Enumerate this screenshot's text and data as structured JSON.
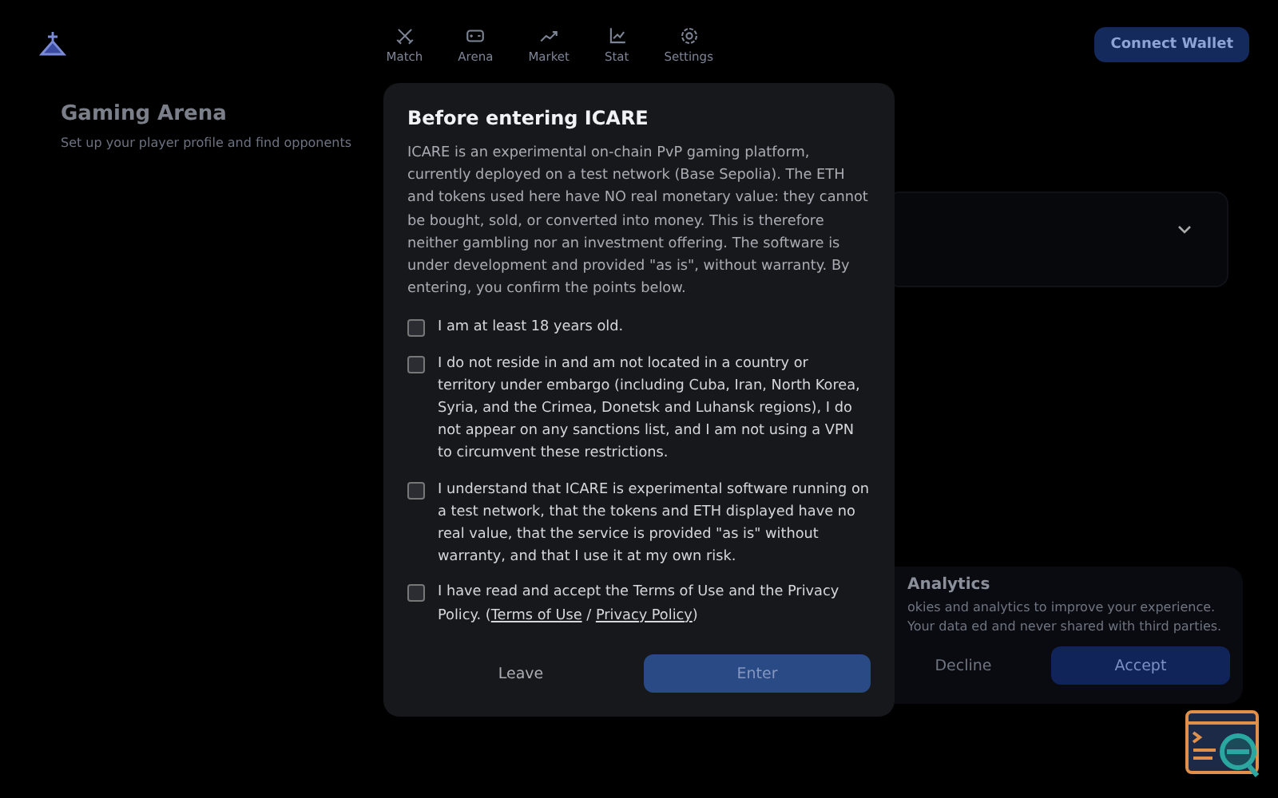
{
  "nav": [
    {
      "label": "Match"
    },
    {
      "label": "Arena"
    },
    {
      "label": "Market"
    },
    {
      "label": "Stat"
    },
    {
      "label": "Settings"
    }
  ],
  "connect_button": "Connect Wallet",
  "page": {
    "title": "Gaming Arena",
    "subtitle": "Set up your player profile and find opponents"
  },
  "analytics": {
    "title": "Analytics",
    "text": "okies and analytics to improve your experience. Your data ed and never shared with third parties.",
    "decline": "Decline",
    "accept": "Accept"
  },
  "modal": {
    "title": "Before entering ICARE",
    "body": "ICARE is an experimental on-chain PvP gaming platform, currently deployed on a test network (Base Sepolia). The ETH and tokens used here have NO real monetary value: they cannot be bought, sold, or converted into money. This is therefore neither gambling nor an investment offering. The software is under development and provided \"as is\", without warranty. By entering, you confirm the points below.",
    "items": [
      {
        "checked": false,
        "parts": [
          {
            "kind": "text",
            "text": "I am at least 18 years old."
          }
        ]
      },
      {
        "checked": false,
        "parts": [
          {
            "kind": "text",
            "text": "I do not reside in and am not located in a country or territory under embargo (including Cuba, Iran, North Korea, Syria, and the Crimea, Donetsk and Luhansk regions), I do not appear on any sanctions list, and I am not using a VPN to circumvent these restrictions."
          }
        ]
      },
      {
        "checked": false,
        "parts": [
          {
            "kind": "text",
            "text": "I understand that ICARE is experimental software running on a test network, that the tokens and ETH displayed have no real value, that the service is provided \"as is\" without warranty, and that I use it at my own risk."
          }
        ]
      },
      {
        "checked": false,
        "parts": [
          {
            "kind": "text",
            "text": "I have read and accept the Terms of Use and the Privacy Policy. ("
          },
          {
            "kind": "link",
            "text": "Terms of Use"
          },
          {
            "kind": "text",
            "text": " / "
          },
          {
            "kind": "link",
            "text": "Privacy Policy"
          },
          {
            "kind": "text",
            "text": ")"
          }
        ]
      }
    ],
    "leave": "Leave",
    "enter": {
      "label": "Enter",
      "disabled": true
    }
  }
}
